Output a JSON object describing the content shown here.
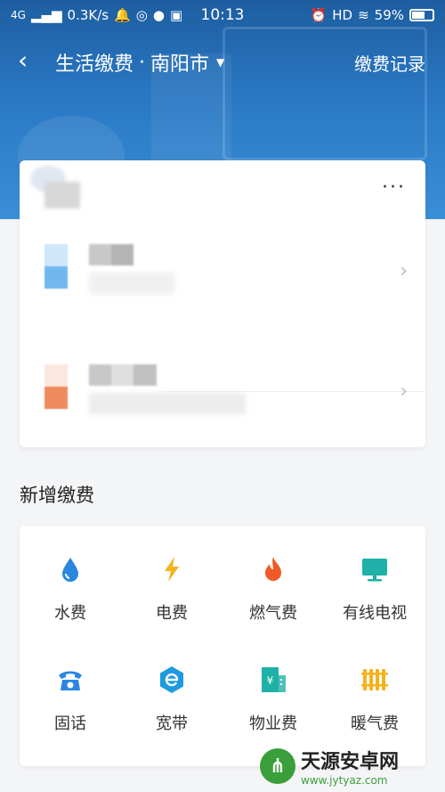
{
  "status_bar": {
    "network": "4G",
    "speed": "0.3K/s",
    "time": "10:13",
    "hd": "HD",
    "battery": "59%"
  },
  "nav": {
    "title": "生活缴费",
    "separator": "·",
    "city": "南阳市",
    "record": "缴费记录"
  },
  "accounts": {
    "more_label": "···"
  },
  "new_payment": {
    "title": "新增缴费",
    "items": [
      {
        "label": "水费",
        "icon": "water-drop-icon",
        "color": "#2a86e0"
      },
      {
        "label": "电费",
        "icon": "lightning-icon",
        "color": "#f4b31c"
      },
      {
        "label": "燃气费",
        "icon": "flame-icon",
        "color": "#f05a28"
      },
      {
        "label": "有线电视",
        "icon": "tv-icon",
        "color": "#1fb1a7"
      },
      {
        "label": "固话",
        "icon": "telephone-icon",
        "color": "#2a86e0"
      },
      {
        "label": "宽带",
        "icon": "broadband-icon",
        "color": "#1e9be0"
      },
      {
        "label": "物业费",
        "icon": "building-yuan-icon",
        "color": "#1fb1a7"
      },
      {
        "label": "暖气费",
        "icon": "radiator-icon",
        "color": "#f4b31c"
      }
    ]
  },
  "watermark": {
    "text": "天源安卓网",
    "url": "www.jytyaz.com"
  }
}
